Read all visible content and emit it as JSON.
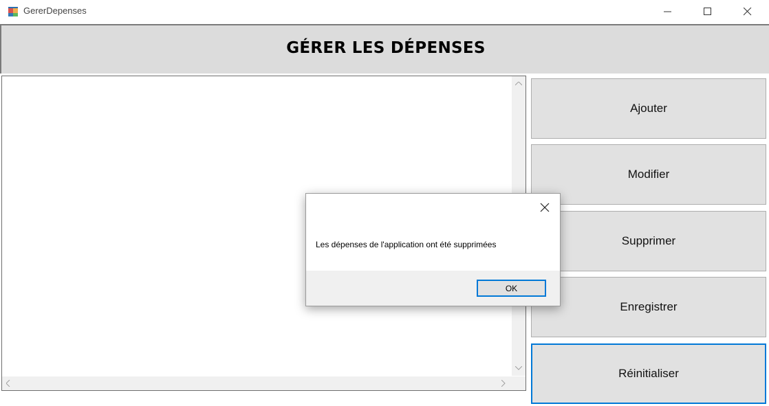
{
  "window": {
    "title": "GererDepenses",
    "icon": "winforms-app-icon",
    "controls": [
      "minimize-icon",
      "maximize-icon",
      "close-icon"
    ]
  },
  "header": {
    "title": "GÉRER LES DÉPENSES"
  },
  "list": {
    "items": []
  },
  "buttons": {
    "ajouter": "Ajouter",
    "modifier": "Modifier",
    "supprimer": "Supprimer",
    "enregistrer": "Enregistrer",
    "reinitialiser": "Réinitialiser"
  },
  "dialog": {
    "message": "Les dépenses de l'application ont été supprimées",
    "ok_label": "OK"
  },
  "colors": {
    "focus_accent": "#0078d7",
    "button_face": "#e1e1e1",
    "header_bg": "#dcdcdc"
  }
}
